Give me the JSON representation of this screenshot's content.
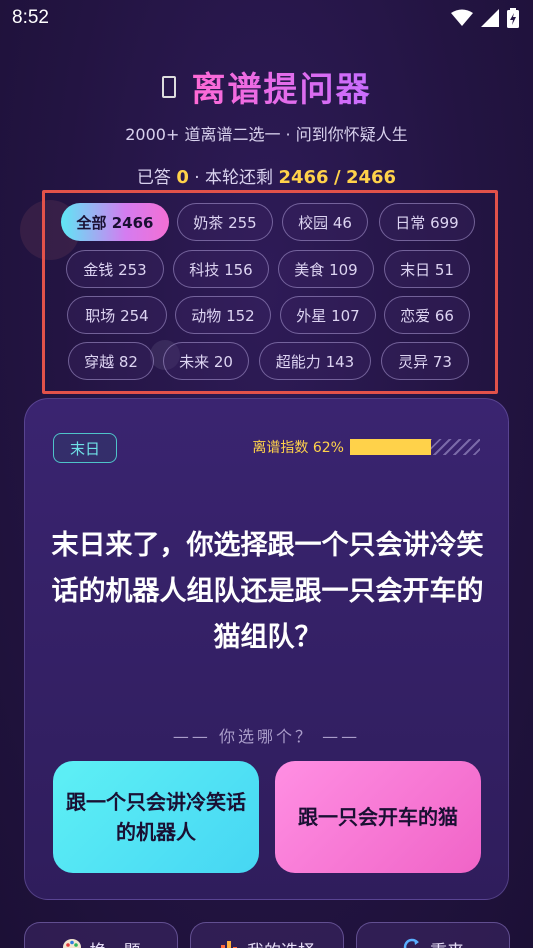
{
  "status_bar": {
    "time": "8:52",
    "icons": [
      "wifi-icon",
      "signal-icon",
      "battery-charging-icon"
    ]
  },
  "header": {
    "title": "离谱提问器",
    "subtitle": "2000+ 道离谱二选一 · 问到你怀疑人生",
    "stats_prefix": "已答",
    "answered": "0",
    "stats_mid": "· 本轮还剩",
    "remaining": "2466",
    "slash": "/",
    "total": "2466"
  },
  "categories": [
    {
      "label": "全部 2466",
      "active": true
    },
    {
      "label": "奶茶 255"
    },
    {
      "label": "校园 46"
    },
    {
      "label": "日常 699"
    },
    {
      "label": "金钱 253"
    },
    {
      "label": "科技 156"
    },
    {
      "label": "美食 109"
    },
    {
      "label": "末日 51"
    },
    {
      "label": "职场 254"
    },
    {
      "label": "动物 152"
    },
    {
      "label": "外星 107"
    },
    {
      "label": "恋爱 66"
    },
    {
      "label": "穿越 82"
    },
    {
      "label": "未来 20"
    },
    {
      "label": "超能力 143"
    },
    {
      "label": "灵异 73"
    }
  ],
  "card": {
    "tag": "末日",
    "absurd_label": "离谱指数 62%",
    "absurd_value": 0.62,
    "question": "末日来了，你选择跟一个只会讲冷笑话的机器人组队还是跟一只会开车的猫组队？",
    "prompt": "—— 你选哪个？ ——",
    "option_a": "跟一个只会讲冷笑话的机器人",
    "option_b": "跟一只会开车的猫"
  },
  "bottom": {
    "skip": "换一题",
    "my_choices": "我的选择",
    "restart": "重来"
  },
  "colors": {
    "accent_yellow": "#ffd24a",
    "cyan": "#5ef0f5",
    "pink": "#f064c7",
    "highlight_border": "#e2524a"
  }
}
